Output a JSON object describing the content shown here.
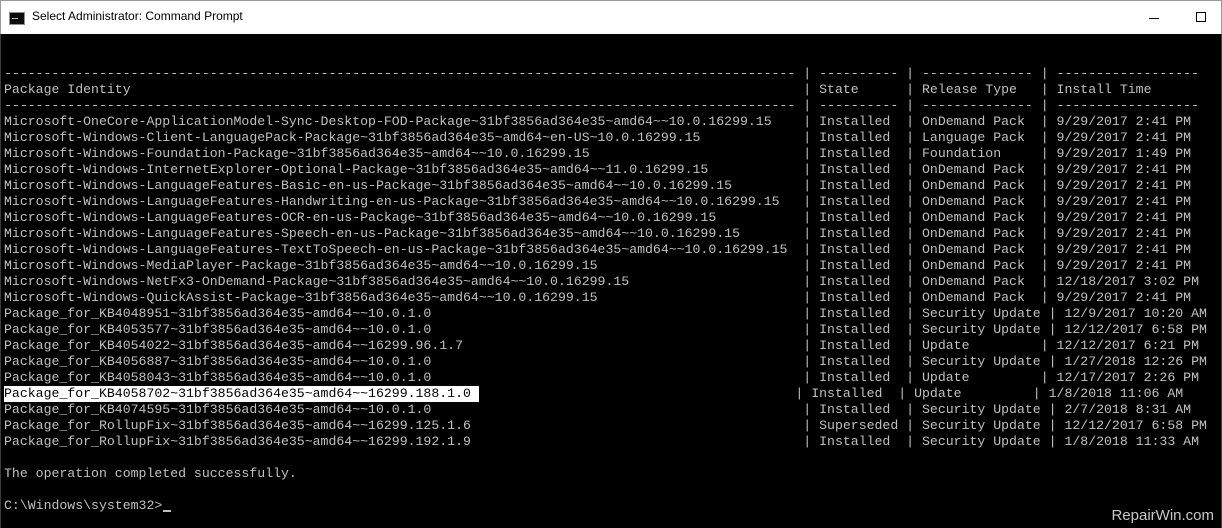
{
  "window": {
    "title": "Select Administrator: Command Prompt"
  },
  "console": {
    "lines": [
      "---------------------------------------------------------------------------------------------------- | ---------- | -------------- | ------------------",
      "Package Identity                                                                                     | State      | Release Type   | Install Time",
      "---------------------------------------------------------------------------------------------------- | ---------- | -------------- | ------------------",
      "Microsoft-OneCore-ApplicationModel-Sync-Desktop-FOD-Package~31bf3856ad364e35~amd64~~10.0.16299.15    | Installed  | OnDemand Pack  | 9/29/2017 2:41 PM",
      "Microsoft-Windows-Client-LanguagePack-Package~31bf3856ad364e35~amd64~en-US~10.0.16299.15             | Installed  | Language Pack  | 9/29/2017 2:41 PM",
      "Microsoft-Windows-Foundation-Package~31bf3856ad364e35~amd64~~10.0.16299.15                           | Installed  | Foundation     | 9/29/2017 1:49 PM",
      "Microsoft-Windows-InternetExplorer-Optional-Package~31bf3856ad364e35~amd64~~11.0.16299.15            | Installed  | OnDemand Pack  | 9/29/2017 2:41 PM",
      "Microsoft-Windows-LanguageFeatures-Basic-en-us-Package~31bf3856ad364e35~amd64~~10.0.16299.15         | Installed  | OnDemand Pack  | 9/29/2017 2:41 PM",
      "Microsoft-Windows-LanguageFeatures-Handwriting-en-us-Package~31bf3856ad364e35~amd64~~10.0.16299.15   | Installed  | OnDemand Pack  | 9/29/2017 2:41 PM",
      "Microsoft-Windows-LanguageFeatures-OCR-en-us-Package~31bf3856ad364e35~amd64~~10.0.16299.15           | Installed  | OnDemand Pack  | 9/29/2017 2:41 PM",
      "Microsoft-Windows-LanguageFeatures-Speech-en-us-Package~31bf3856ad364e35~amd64~~10.0.16299.15        | Installed  | OnDemand Pack  | 9/29/2017 2:41 PM",
      "Microsoft-Windows-LanguageFeatures-TextToSpeech-en-us-Package~31bf3856ad364e35~amd64~~10.0.16299.15  | Installed  | OnDemand Pack  | 9/29/2017 2:41 PM",
      "Microsoft-Windows-MediaPlayer-Package~31bf3856ad364e35~amd64~~10.0.16299.15                          | Installed  | OnDemand Pack  | 9/29/2017 2:41 PM",
      "Microsoft-Windows-NetFx3-OnDemand-Package~31bf3856ad364e35~amd64~~10.0.16299.15                      | Installed  | OnDemand Pack  | 12/18/2017 3:02 PM",
      "Microsoft-Windows-QuickAssist-Package~31bf3856ad364e35~amd64~~10.0.16299.15                          | Installed  | OnDemand Pack  | 9/29/2017 2:41 PM",
      "Package_for_KB4048951~31bf3856ad364e35~amd64~~10.0.1.0                                               | Installed  | Security Update | 12/9/2017 10:20 AM",
      "Package_for_KB4053577~31bf3856ad364e35~amd64~~10.0.1.0                                               | Installed  | Security Update | 12/12/2017 6:58 PM",
      "Package_for_KB4054022~31bf3856ad364e35~amd64~~16299.96.1.7                                           | Installed  | Update         | 12/12/2017 6:21 PM",
      "Package_for_KB4056887~31bf3856ad364e35~amd64~~10.0.1.0                                               | Installed  | Security Update | 1/27/2018 12:26 PM",
      "Package_for_KB4058043~31bf3856ad364e35~amd64~~10.0.1.0                                               | Installed  | Update         | 12/17/2017 2:26 PM",
      "Package_for_KB4058702~31bf3856ad364e35~amd64~~16299.188.1.0",
      "Package_for_KB4074595~31bf3856ad364e35~amd64~~10.0.1.0                                               | Installed  | Security Update | 2/7/2018 8:31 AM",
      "Package_for_RollupFix~31bf3856ad364e35~amd64~~16299.125.1.6                                          | Superseded | Security Update | 12/12/2017 6:58 PM",
      "Package_for_RollupFix~31bf3856ad364e35~amd64~~16299.192.1.9                                          | Installed  | Security Update | 1/8/2018 11:33 AM",
      "",
      "The operation completed successfully.",
      "",
      "C:\\Windows\\system32>"
    ],
    "selected_row_rest": "                                         | Installed  | Update         | 1/8/2018 11:06 AM"
  },
  "watermark": "RepairWin.com"
}
